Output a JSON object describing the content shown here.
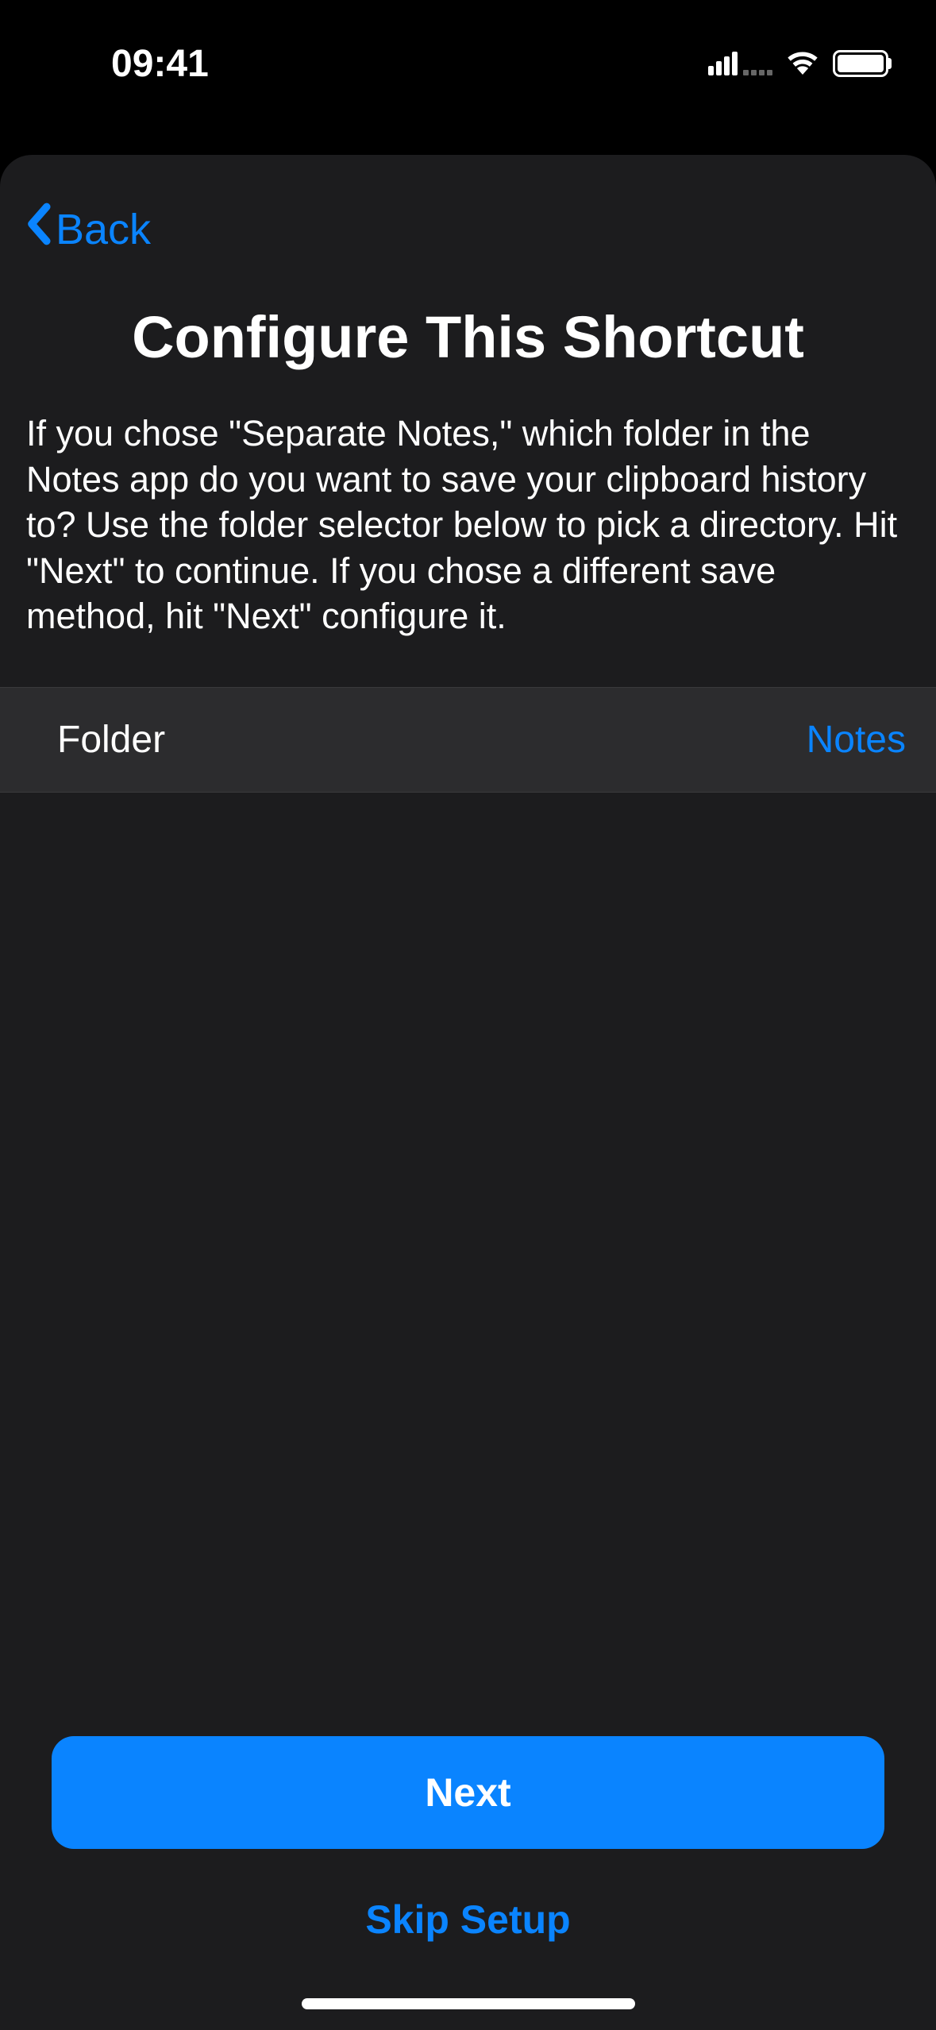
{
  "statusBar": {
    "time": "09:41"
  },
  "nav": {
    "back_label": "Back"
  },
  "header": {
    "title": "Configure This Shortcut",
    "description": "If you chose \"Separate Notes,\" which folder in the Notes app do you want to save your clipboard history to? Use the folder selector below to pick a directory. Hit \"Next\" to continue. If you chose a different save method, hit \"Next\" configure it."
  },
  "form": {
    "folder_label": "Folder",
    "folder_value": "Notes"
  },
  "actions": {
    "next_label": "Next",
    "skip_label": "Skip Setup"
  }
}
